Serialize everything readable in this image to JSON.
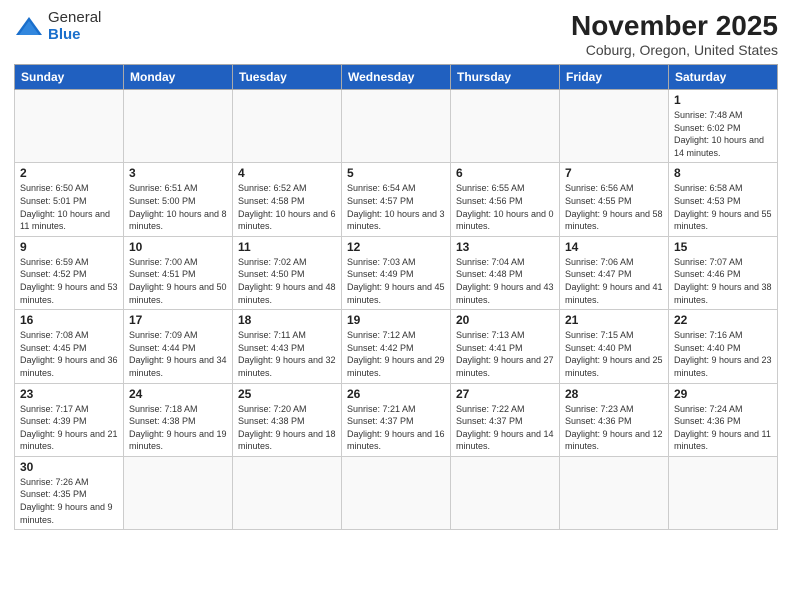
{
  "header": {
    "logo_general": "General",
    "logo_blue": "Blue",
    "title": "November 2025",
    "subtitle": "Coburg, Oregon, United States"
  },
  "days_of_week": [
    "Sunday",
    "Monday",
    "Tuesday",
    "Wednesday",
    "Thursday",
    "Friday",
    "Saturday"
  ],
  "weeks": [
    [
      {
        "day": "",
        "info": ""
      },
      {
        "day": "",
        "info": ""
      },
      {
        "day": "",
        "info": ""
      },
      {
        "day": "",
        "info": ""
      },
      {
        "day": "",
        "info": ""
      },
      {
        "day": "",
        "info": ""
      },
      {
        "day": "1",
        "info": "Sunrise: 7:48 AM\nSunset: 6:02 PM\nDaylight: 10 hours and 14 minutes."
      }
    ],
    [
      {
        "day": "2",
        "info": "Sunrise: 6:50 AM\nSunset: 5:01 PM\nDaylight: 10 hours and 11 minutes."
      },
      {
        "day": "3",
        "info": "Sunrise: 6:51 AM\nSunset: 5:00 PM\nDaylight: 10 hours and 8 minutes."
      },
      {
        "day": "4",
        "info": "Sunrise: 6:52 AM\nSunset: 4:58 PM\nDaylight: 10 hours and 6 minutes."
      },
      {
        "day": "5",
        "info": "Sunrise: 6:54 AM\nSunset: 4:57 PM\nDaylight: 10 hours and 3 minutes."
      },
      {
        "day": "6",
        "info": "Sunrise: 6:55 AM\nSunset: 4:56 PM\nDaylight: 10 hours and 0 minutes."
      },
      {
        "day": "7",
        "info": "Sunrise: 6:56 AM\nSunset: 4:55 PM\nDaylight: 9 hours and 58 minutes."
      },
      {
        "day": "8",
        "info": "Sunrise: 6:58 AM\nSunset: 4:53 PM\nDaylight: 9 hours and 55 minutes."
      }
    ],
    [
      {
        "day": "9",
        "info": "Sunrise: 6:59 AM\nSunset: 4:52 PM\nDaylight: 9 hours and 53 minutes."
      },
      {
        "day": "10",
        "info": "Sunrise: 7:00 AM\nSunset: 4:51 PM\nDaylight: 9 hours and 50 minutes."
      },
      {
        "day": "11",
        "info": "Sunrise: 7:02 AM\nSunset: 4:50 PM\nDaylight: 9 hours and 48 minutes."
      },
      {
        "day": "12",
        "info": "Sunrise: 7:03 AM\nSunset: 4:49 PM\nDaylight: 9 hours and 45 minutes."
      },
      {
        "day": "13",
        "info": "Sunrise: 7:04 AM\nSunset: 4:48 PM\nDaylight: 9 hours and 43 minutes."
      },
      {
        "day": "14",
        "info": "Sunrise: 7:06 AM\nSunset: 4:47 PM\nDaylight: 9 hours and 41 minutes."
      },
      {
        "day": "15",
        "info": "Sunrise: 7:07 AM\nSunset: 4:46 PM\nDaylight: 9 hours and 38 minutes."
      }
    ],
    [
      {
        "day": "16",
        "info": "Sunrise: 7:08 AM\nSunset: 4:45 PM\nDaylight: 9 hours and 36 minutes."
      },
      {
        "day": "17",
        "info": "Sunrise: 7:09 AM\nSunset: 4:44 PM\nDaylight: 9 hours and 34 minutes."
      },
      {
        "day": "18",
        "info": "Sunrise: 7:11 AM\nSunset: 4:43 PM\nDaylight: 9 hours and 32 minutes."
      },
      {
        "day": "19",
        "info": "Sunrise: 7:12 AM\nSunset: 4:42 PM\nDaylight: 9 hours and 29 minutes."
      },
      {
        "day": "20",
        "info": "Sunrise: 7:13 AM\nSunset: 4:41 PM\nDaylight: 9 hours and 27 minutes."
      },
      {
        "day": "21",
        "info": "Sunrise: 7:15 AM\nSunset: 4:40 PM\nDaylight: 9 hours and 25 minutes."
      },
      {
        "day": "22",
        "info": "Sunrise: 7:16 AM\nSunset: 4:40 PM\nDaylight: 9 hours and 23 minutes."
      }
    ],
    [
      {
        "day": "23",
        "info": "Sunrise: 7:17 AM\nSunset: 4:39 PM\nDaylight: 9 hours and 21 minutes."
      },
      {
        "day": "24",
        "info": "Sunrise: 7:18 AM\nSunset: 4:38 PM\nDaylight: 9 hours and 19 minutes."
      },
      {
        "day": "25",
        "info": "Sunrise: 7:20 AM\nSunset: 4:38 PM\nDaylight: 9 hours and 18 minutes."
      },
      {
        "day": "26",
        "info": "Sunrise: 7:21 AM\nSunset: 4:37 PM\nDaylight: 9 hours and 16 minutes."
      },
      {
        "day": "27",
        "info": "Sunrise: 7:22 AM\nSunset: 4:37 PM\nDaylight: 9 hours and 14 minutes."
      },
      {
        "day": "28",
        "info": "Sunrise: 7:23 AM\nSunset: 4:36 PM\nDaylight: 9 hours and 12 minutes."
      },
      {
        "day": "29",
        "info": "Sunrise: 7:24 AM\nSunset: 4:36 PM\nDaylight: 9 hours and 11 minutes."
      }
    ],
    [
      {
        "day": "30",
        "info": "Sunrise: 7:26 AM\nSunset: 4:35 PM\nDaylight: 9 hours and 9 minutes."
      },
      {
        "day": "",
        "info": ""
      },
      {
        "day": "",
        "info": ""
      },
      {
        "day": "",
        "info": ""
      },
      {
        "day": "",
        "info": ""
      },
      {
        "day": "",
        "info": ""
      },
      {
        "day": "",
        "info": ""
      }
    ]
  ]
}
